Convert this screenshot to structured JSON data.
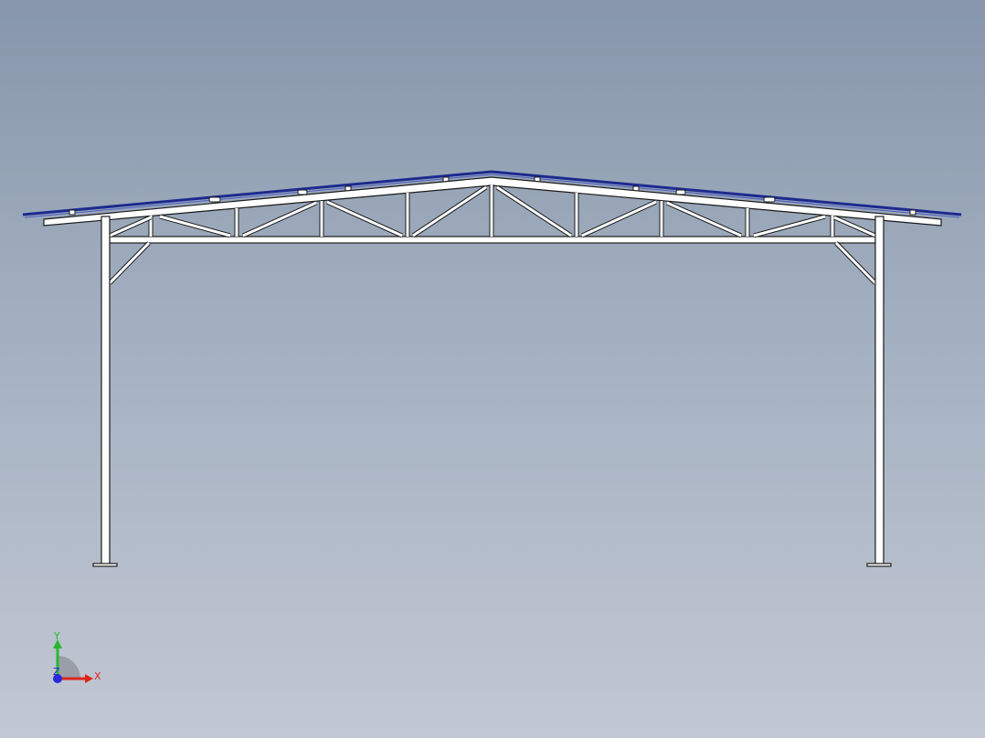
{
  "triad": {
    "x_label": "X",
    "y_label": "Y",
    "z_label": "Z",
    "x_color": "#e0241b",
    "y_color": "#27b833",
    "z_color": "#2a2ad6"
  },
  "colors": {
    "background_top": "#8796ab",
    "background_bottom": "#c2c8d3",
    "member_fill": "#ffffff",
    "member_edge": "#1a1a1a",
    "roof_sheet": "#1c2a8f"
  }
}
